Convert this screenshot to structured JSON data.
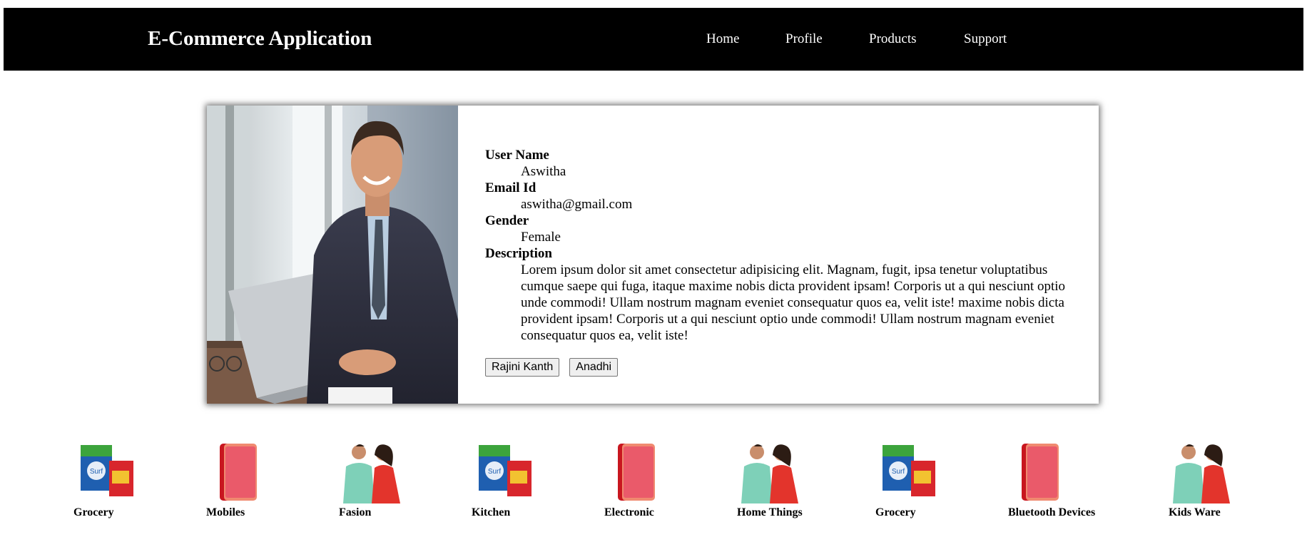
{
  "header": {
    "brand": "E-Commerce Application",
    "nav": [
      "Home",
      "Profile",
      "Products",
      "Support"
    ]
  },
  "profile": {
    "fields": [
      {
        "label": "User Name",
        "value": "Aswitha"
      },
      {
        "label": "Email Id",
        "value": "aswitha@gmail.com"
      },
      {
        "label": "Gender",
        "value": "Female"
      },
      {
        "label": "Description",
        "value": "Lorem ipsum dolor sit amet consectetur adipisicing elit. Magnam, fugit, ipsa tenetur voluptatibus cumque saepe qui fuga, itaque maxime nobis dicta provident ipsam! Corporis ut a qui nesciunt optio unde commodi! Ullam nostrum magnam eveniet consequatur quos ea, velit iste! maxime nobis dicta provident ipsam! Corporis ut a qui nesciunt optio unde commodi! Ullam nostrum magnam eveniet consequatur quos ea, velit iste!"
      }
    ],
    "buttons": [
      "Rajini Kanth",
      "Anadhi"
    ],
    "photo_icon": "businessman-at-laptop-photo"
  },
  "categories": [
    {
      "label": "Grocery",
      "icon": "grocery-pack-icon"
    },
    {
      "label": "Mobiles",
      "icon": "mobile-phone-icon"
    },
    {
      "label": "Fasion",
      "icon": "fashion-couple-icon"
    },
    {
      "label": "Kitchen",
      "icon": "grocery-pack-icon"
    },
    {
      "label": "Electronic",
      "icon": "mobile-phone-icon"
    },
    {
      "label": "Home Things",
      "icon": "fashion-couple-icon"
    },
    {
      "label": "Grocery",
      "icon": "grocery-pack-icon"
    },
    {
      "label": "Bluetooth Devices",
      "icon": "mobile-phone-icon"
    },
    {
      "label": "Kids Ware",
      "icon": "fashion-couple-icon"
    }
  ]
}
